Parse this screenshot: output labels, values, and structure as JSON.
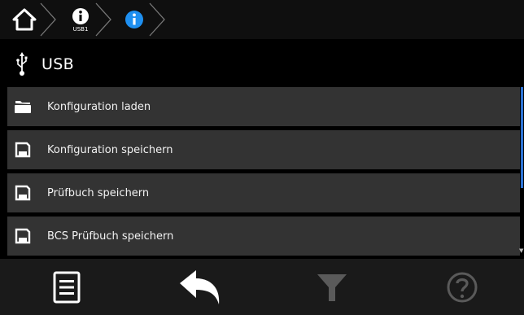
{
  "breadcrumb": {
    "items": [
      {
        "icon": "home-icon",
        "sub": ""
      },
      {
        "icon": "info-icon",
        "sub": "USB1"
      },
      {
        "icon": "info-icon-active",
        "sub": ""
      }
    ]
  },
  "title": {
    "icon": "usb-icon",
    "text": "USB"
  },
  "menu": {
    "items": [
      {
        "icon": "folder-open-icon",
        "label": "Konfiguration laden"
      },
      {
        "icon": "floppy-disk-icon",
        "label": "Konfiguration speichern"
      },
      {
        "icon": "floppy-disk-icon",
        "label": "Prüfbuch speichern"
      },
      {
        "icon": "floppy-disk-icon",
        "label": "BCS Prüfbuch speichern"
      }
    ]
  },
  "toolbar": {
    "buttons": [
      {
        "icon": "list-icon",
        "state": "enabled"
      },
      {
        "icon": "back-arrow-icon",
        "state": "enabled"
      },
      {
        "icon": "filter-icon",
        "state": "disabled"
      },
      {
        "icon": "help-icon",
        "state": "disabled"
      }
    ]
  },
  "colors": {
    "accent": "#1e8ff0",
    "item_bg": "#333333",
    "toolbar_bg": "#1a1a1a",
    "disabled_icon": "#5a5a5a",
    "scrollbar": "#2e74d6"
  }
}
